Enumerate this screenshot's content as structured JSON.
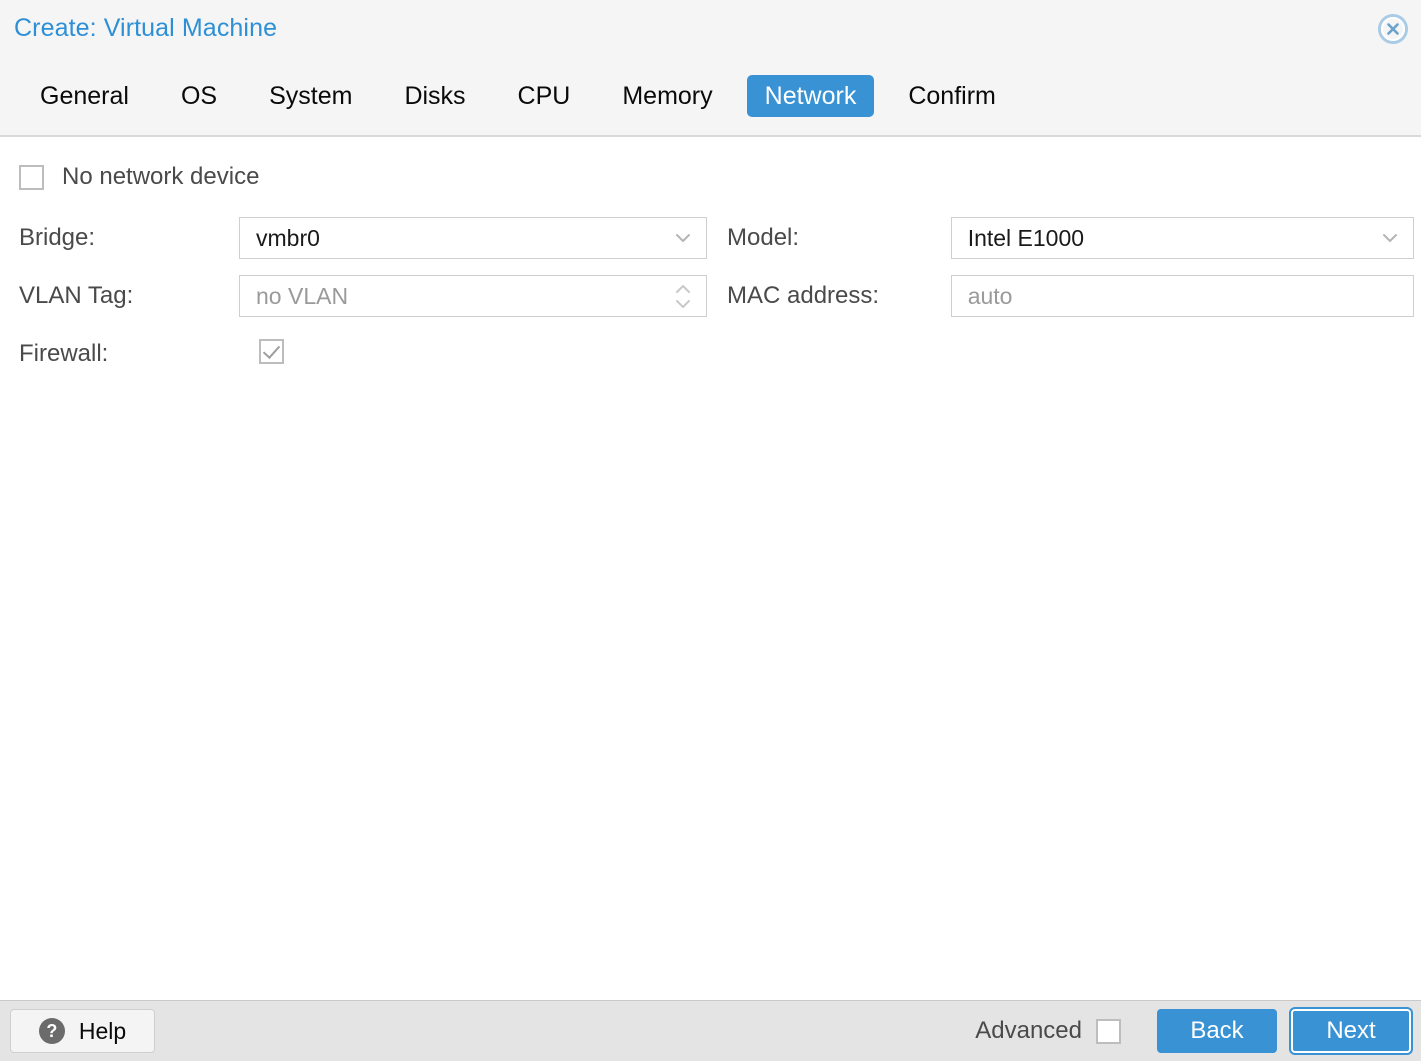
{
  "window": {
    "title": "Create: Virtual Machine",
    "close_icon": "close-circle-icon"
  },
  "tabs": [
    {
      "label": "General",
      "active": false
    },
    {
      "label": "OS",
      "active": false
    },
    {
      "label": "System",
      "active": false
    },
    {
      "label": "Disks",
      "active": false
    },
    {
      "label": "CPU",
      "active": false
    },
    {
      "label": "Memory",
      "active": false
    },
    {
      "label": "Network",
      "active": true
    },
    {
      "label": "Confirm",
      "active": false
    }
  ],
  "form": {
    "no_network_device": {
      "label": "No network device",
      "checked": false
    },
    "bridge": {
      "label": "Bridge:",
      "value": "vmbr0",
      "is_placeholder": false,
      "trigger_icon": "chevron-down-icon"
    },
    "vlan_tag": {
      "label": "VLAN Tag:",
      "value": "no VLAN",
      "is_placeholder": true,
      "trigger_icon": "spinner-updown-icon"
    },
    "firewall": {
      "label": "Firewall:",
      "checked": true
    },
    "model": {
      "label": "Model:",
      "value": "Intel E1000",
      "is_placeholder": false,
      "trigger_icon": "chevron-down-icon"
    },
    "mac_address": {
      "label": "MAC address:",
      "value": "auto",
      "is_placeholder": true
    }
  },
  "footer": {
    "help_label": "Help",
    "help_icon": "question-mark-icon",
    "advanced_label": "Advanced",
    "advanced_checked": false,
    "back_label": "Back",
    "next_label": "Next"
  },
  "colors": {
    "accent": "#3892d4",
    "title": "#2d8fd5",
    "header_bg": "#f5f5f5",
    "footer_bg": "#e4e4e4",
    "label": "#4a4a4a",
    "placeholder": "#9a9a9a"
  }
}
